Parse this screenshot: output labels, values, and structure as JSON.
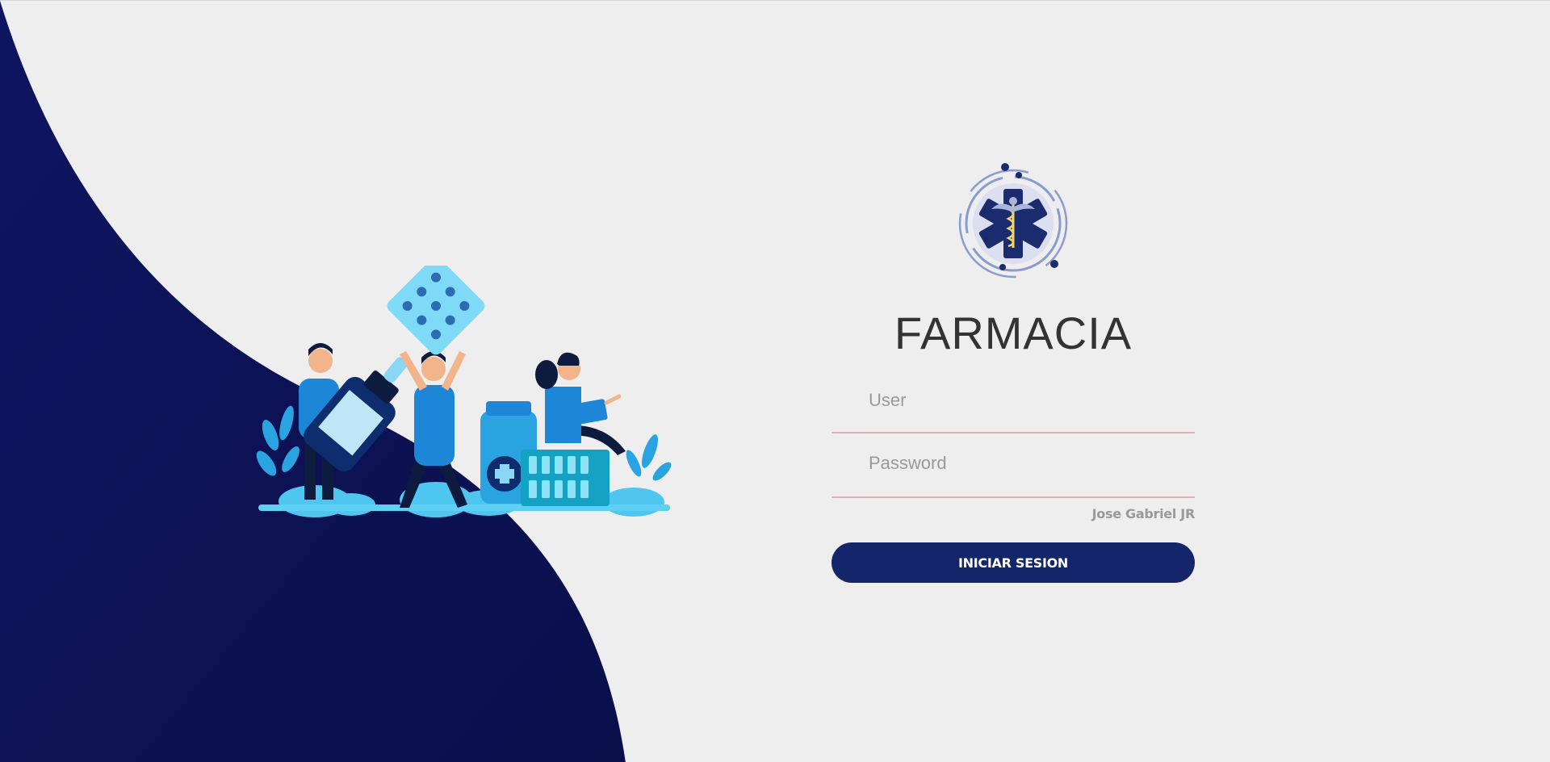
{
  "brand": {
    "title": "FARMACIA",
    "author": "Jose Gabriel JR"
  },
  "form": {
    "user_placeholder": "User",
    "password_placeholder": "Password",
    "submit_label": "INICIAR SESION"
  },
  "icons": {
    "logo": "star-of-life-caduceus-icon",
    "illustration": "pharmacy-people-illustration"
  },
  "colors": {
    "wave": "#0c1150",
    "button": "#142669",
    "background": "#eeeeee",
    "input_underline": "#d9b4b8"
  }
}
